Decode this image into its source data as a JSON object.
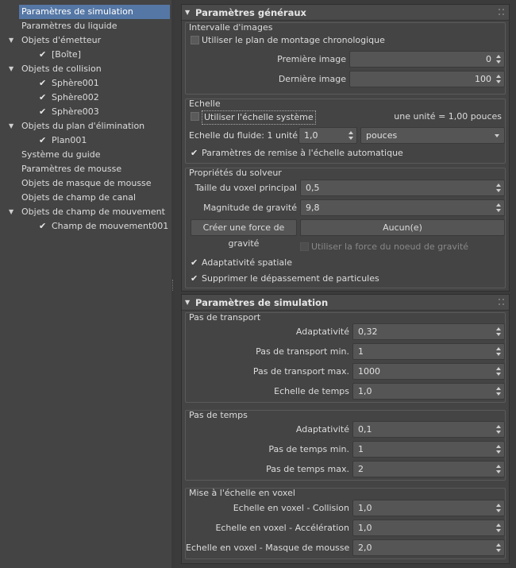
{
  "tree": {
    "items": [
      {
        "label": "Paramètres de simulation",
        "level": 0,
        "arrow": false,
        "checked": false,
        "selected": true
      },
      {
        "label": "Paramètres du liquide",
        "level": 0,
        "arrow": false,
        "checked": false,
        "selected": false
      },
      {
        "label": "Objets d'émetteur",
        "level": 0,
        "arrow": true,
        "checked": false,
        "selected": false
      },
      {
        "label": "[Boîte]",
        "level": 1,
        "arrow": false,
        "checked": true,
        "selected": false
      },
      {
        "label": "Objets de collision",
        "level": 0,
        "arrow": true,
        "checked": false,
        "selected": false
      },
      {
        "label": "Sphère001",
        "level": 1,
        "arrow": false,
        "checked": true,
        "selected": false
      },
      {
        "label": "Sphère002",
        "level": 1,
        "arrow": false,
        "checked": true,
        "selected": false
      },
      {
        "label": "Sphère003",
        "level": 1,
        "arrow": false,
        "checked": true,
        "selected": false
      },
      {
        "label": "Objets du plan d'élimination",
        "level": 0,
        "arrow": true,
        "checked": false,
        "selected": false
      },
      {
        "label": "Plan001",
        "level": 1,
        "arrow": false,
        "checked": true,
        "selected": false
      },
      {
        "label": "Système du guide",
        "level": 0,
        "arrow": false,
        "checked": false,
        "selected": false
      },
      {
        "label": "Paramètres de mousse",
        "level": 0,
        "arrow": false,
        "checked": false,
        "selected": false
      },
      {
        "label": "Objets de masque de mousse",
        "level": 0,
        "arrow": false,
        "checked": false,
        "selected": false
      },
      {
        "label": "Objets de champ de canal",
        "level": 0,
        "arrow": false,
        "checked": false,
        "selected": false
      },
      {
        "label": "Objets de champ de mouvement",
        "level": 0,
        "arrow": true,
        "checked": false,
        "selected": false
      },
      {
        "label": "Champ de mouvement001",
        "level": 1,
        "arrow": false,
        "checked": true,
        "selected": false
      }
    ]
  },
  "general": {
    "title": "Paramètres généraux",
    "frames": {
      "group_label": "Intervalle d'images",
      "use_timeline_label": "Utiliser le plan de montage chronologique",
      "use_timeline_checked": false,
      "first_label": "Première image",
      "first_value": "0",
      "last_label": "Dernière image",
      "last_value": "100"
    },
    "scale": {
      "group_label": "Echelle",
      "use_system_label": "Utiliser l'échelle système",
      "use_system_checked": false,
      "unit_info": "une unité = 1,00 pouces",
      "fluid_scale_label": "Echelle du fluide: 1 unité =",
      "fluid_scale_value": "1,0",
      "unit_value": "pouces",
      "auto_rescale_label": "Paramètres de remise à l'échelle automatique",
      "auto_rescale_checked": true
    },
    "solver": {
      "group_label": "Propriétés du solveur",
      "voxel_label": "Taille du voxel principal",
      "voxel_value": "0,5",
      "gravity_label": "Magnitude de gravité",
      "gravity_value": "9,8",
      "create_gravity_label": "Créer une force de gravité",
      "gravity_node_value": "Aucun(e)",
      "use_node_force_label": "Utiliser la force du noeud de gravité",
      "use_node_force_checked": false,
      "spatial_label": "Adaptativité spatiale",
      "spatial_checked": true,
      "overshoot_label": "Supprimer le dépassement de particules",
      "overshoot_checked": true
    }
  },
  "simulation": {
    "title": "Paramètres de simulation",
    "transport": {
      "group_label": "Pas de transport",
      "adaptivity_label": "Adaptativité",
      "adaptivity_value": "0,32",
      "min_label": "Pas de transport min.",
      "min_value": "1",
      "max_label": "Pas de transport max.",
      "max_value": "1000",
      "timescale_label": "Echelle de temps",
      "timescale_value": "1,0"
    },
    "timestep": {
      "group_label": "Pas de temps",
      "adaptivity_label": "Adaptativité",
      "adaptivity_value": "0,1",
      "min_label": "Pas de temps min.",
      "min_value": "1",
      "max_label": "Pas de temps max.",
      "max_value": "2"
    },
    "voxel_scale": {
      "group_label": "Mise à l'échelle en voxel",
      "collision_label": "Echelle en voxel - Collision",
      "collision_value": "1,0",
      "accel_label": "Echelle en voxel - Accélération",
      "accel_value": "1,0",
      "foam_label": "Echelle en voxel - Masque de mousse",
      "foam_value": "2,0"
    }
  }
}
